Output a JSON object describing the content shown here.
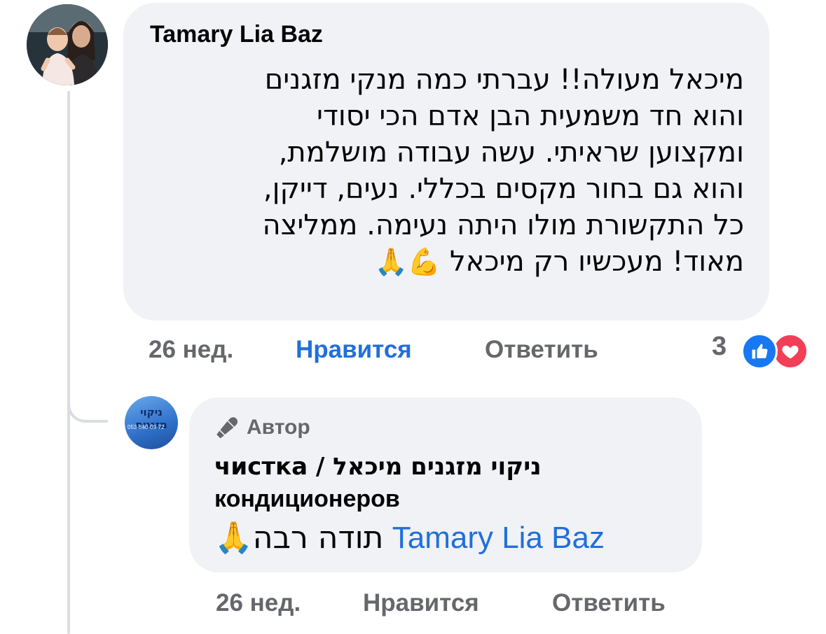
{
  "comment": {
    "author": "Tamary Lia Baz",
    "text_lines": [
      "מיכאל מעולה!! עברתי כמה מנקי מזגנים",
      "והוא חד משמעית הבן אדם הכי יסודי",
      "ומקצוען שראיתי. עשה עבודה מושלמת,",
      "והוא גם בחור מקסים בכללי. נעים, דייקן,",
      "כל התקשורת מולו היתה נעימה. ממליצה",
      "מאוד! מעכשיו רק מיכאל"
    ],
    "text_emojis": "💪🙏",
    "time": "26 нед.",
    "like_label": "Нравится",
    "reply_label": "Ответить",
    "reaction_count": "3",
    "reaction_icons": [
      "like-icon",
      "love-icon"
    ],
    "like_color": "#216fdb"
  },
  "reply": {
    "avatar_title": "ניקוי מזגנים",
    "avatar_sub": "053-840-09-72",
    "author_badge": "Автор",
    "author_badge_icon": "microphone-icon",
    "author_lines": [
      "ניקוי מזגנים מיכאל / чистка",
      "кондиционеров"
    ],
    "mention": "Tamary Lia Baz",
    "text": "תודה רבה",
    "text_emoji": "🙏",
    "time": "26 нед.",
    "like_label": "Нравится",
    "reply_label": "Ответить"
  },
  "colors": {
    "bubble": "#f0f2f5",
    "muted": "#65676b",
    "link": "#216fdb",
    "like_badge": "#1877f2",
    "love_badge": "#f33e58"
  }
}
